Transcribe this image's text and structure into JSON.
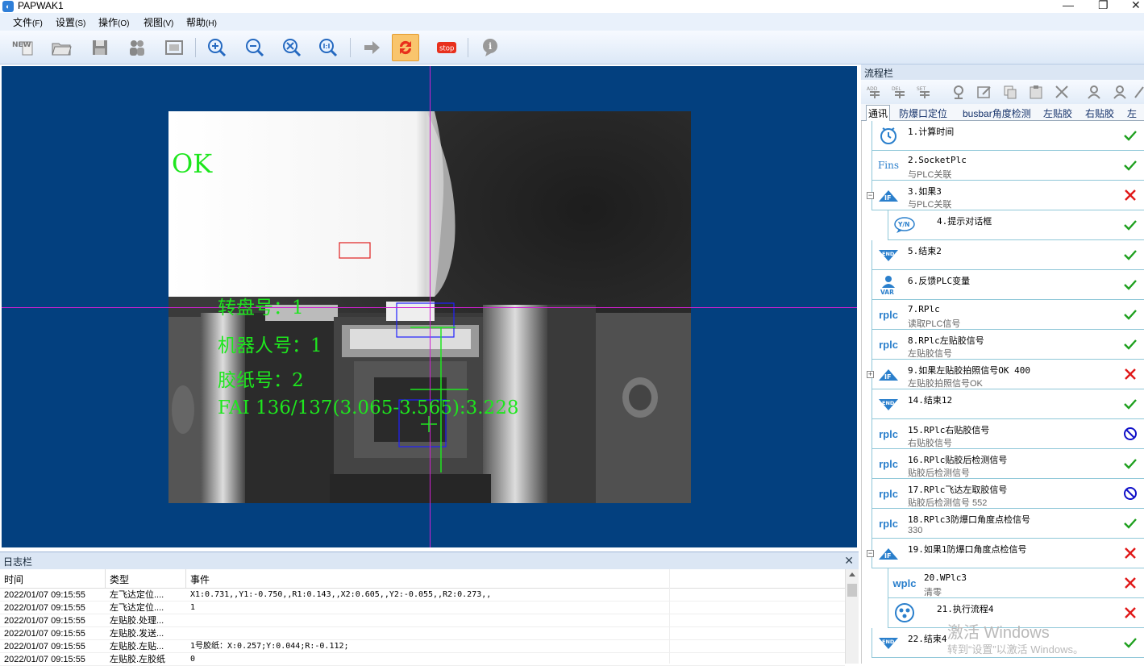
{
  "window": {
    "title": "PAPWAK1",
    "app_icon": "app-logo-icon"
  },
  "menu": [
    {
      "label": "文件",
      "key": "(F)"
    },
    {
      "label": "设置",
      "key": "(S)"
    },
    {
      "label": "操作",
      "key": "(O)"
    },
    {
      "label": "视图",
      "key": "(V)"
    },
    {
      "label": "帮助",
      "key": "(H)"
    }
  ],
  "toolbar": {
    "new_label": "NEW",
    "stop_label": "stop",
    "active_button": "cycle-run-button"
  },
  "canvas": {
    "background": "#03407f",
    "crosshair_color": "#d020d0",
    "overlay_color": "#1ee61e",
    "result_text": "OK",
    "lines": [
      "转盘号：1",
      "机器人号：1",
      "胶纸号：2",
      "FAI 136/137(3.065-3.565):3.228"
    ]
  },
  "log": {
    "title": "日志栏",
    "columns": [
      "时间",
      "类型",
      "事件"
    ],
    "rows": [
      {
        "time": "2022/01/07 09:15:55",
        "type": "左飞达定位....",
        "event": "X1:0.731,,Y1:-0.750,,R1:0.143,,X2:0.605,,Y2:-0.055,,R2:0.273,,"
      },
      {
        "time": "2022/01/07 09:15:55",
        "type": "左飞达定位....",
        "event": "1"
      },
      {
        "time": "2022/01/07 09:15:55",
        "type": "左贴胶.处理...",
        "event": ""
      },
      {
        "time": "2022/01/07 09:15:55",
        "type": "左贴胶.发送...",
        "event": ""
      },
      {
        "time": "2022/01/07 09:15:55",
        "type": "左贴胶.左贴...",
        "event": "1号胶纸：X:0.257;Y:0.044;R:-0.112;"
      },
      {
        "time": "2022/01/07 09:15:55",
        "type": "左贴胶.左胶纸",
        "event": "0"
      }
    ]
  },
  "flow_panel": {
    "title": "流程栏",
    "tabs": [
      "通讯",
      "防爆口定位",
      "busbar角度检测",
      "左贴胶",
      "右贴胶",
      "左"
    ],
    "active_tab": 0,
    "status_colors": {
      "ok": "#1fa01f",
      "fail": "#e01818",
      "disabled": "#1010c8"
    },
    "items": [
      {
        "name": "1.计算时间",
        "sub": "",
        "icon": "clock-icon",
        "status": "ok",
        "indent": 0
      },
      {
        "name": "2.SocketPlc",
        "sub": "与PLC关联",
        "icon": "fins-icon",
        "icon_text": "Fins",
        "status": "ok",
        "indent": 0
      },
      {
        "name": "3.如果3",
        "sub": "与PLC关联",
        "icon": "if-icon",
        "icon_text": "IF",
        "status": "fail",
        "indent": 0,
        "expander": "−"
      },
      {
        "name": "4.提示对话框",
        "sub": "",
        "icon": "dialog-yn-icon",
        "icon_text": "Y/N",
        "status": "ok",
        "indent": 1
      },
      {
        "name": "5.结束2",
        "sub": "",
        "icon": "end-icon",
        "icon_text": "END",
        "status": "ok",
        "indent": 0
      },
      {
        "name": "6.反馈PLC变量",
        "sub": "",
        "icon": "var-icon",
        "icon_text": "VAR",
        "status": "ok",
        "indent": 0
      },
      {
        "name": "7.RPlc",
        "sub": "读取PLC信号",
        "icon": "rplc-icon",
        "icon_text": "rplc",
        "status": "ok",
        "indent": 0
      },
      {
        "name": "8.RPlc左贴胶信号",
        "sub": "左贴胶信号",
        "icon": "rplc-icon",
        "icon_text": "rplc",
        "status": "ok",
        "indent": 0
      },
      {
        "name": "9.如果左贴胶拍照信号OK  400",
        "sub": "左贴胶拍照信号OK",
        "icon": "if-icon",
        "icon_text": "IF",
        "status": "fail",
        "indent": 0,
        "expander": "+"
      },
      {
        "name": "14.结束12",
        "sub": "",
        "icon": "end-icon",
        "icon_text": "END",
        "status": "ok",
        "indent": 0
      },
      {
        "name": "15.RPlc右贴胶信号",
        "sub": "右贴胶信号",
        "icon": "rplc-icon",
        "icon_text": "rplc",
        "status": "disabled",
        "indent": 0
      },
      {
        "name": "16.RPlc贴胶后检测信号",
        "sub": "贴胶后检测信号",
        "icon": "rplc-icon",
        "icon_text": "rplc",
        "status": "ok",
        "indent": 0
      },
      {
        "name": "17.RPlc飞达左取胶信号",
        "sub": "贴胶后检测信号   552",
        "icon": "rplc-icon",
        "icon_text": "rplc",
        "status": "disabled",
        "indent": 0
      },
      {
        "name": "18.RPlc3防爆口角度点检信号",
        "sub": "330",
        "icon": "rplc-icon",
        "icon_text": "rplc",
        "status": "ok",
        "indent": 0
      },
      {
        "name": "19.如果1防爆口角度点检信号",
        "sub": "",
        "icon": "if-icon",
        "icon_text": "IF",
        "status": "fail",
        "indent": 0,
        "expander": "−"
      },
      {
        "name": "20.WPlc3",
        "sub": "清零",
        "icon": "wplc-icon",
        "icon_text": "wplc",
        "status": "fail",
        "indent": 1
      },
      {
        "name": "21.执行流程4",
        "sub": "",
        "icon": "run-flow-icon",
        "icon_text": "",
        "status": "fail",
        "indent": 1
      },
      {
        "name": "22.结束4",
        "sub": "",
        "icon": "end-icon",
        "icon_text": "END",
        "status": "ok",
        "indent": 0
      }
    ]
  },
  "watermark": {
    "line1": "激活 Windows",
    "line2": "转到“设置”以激活 Windows。"
  }
}
